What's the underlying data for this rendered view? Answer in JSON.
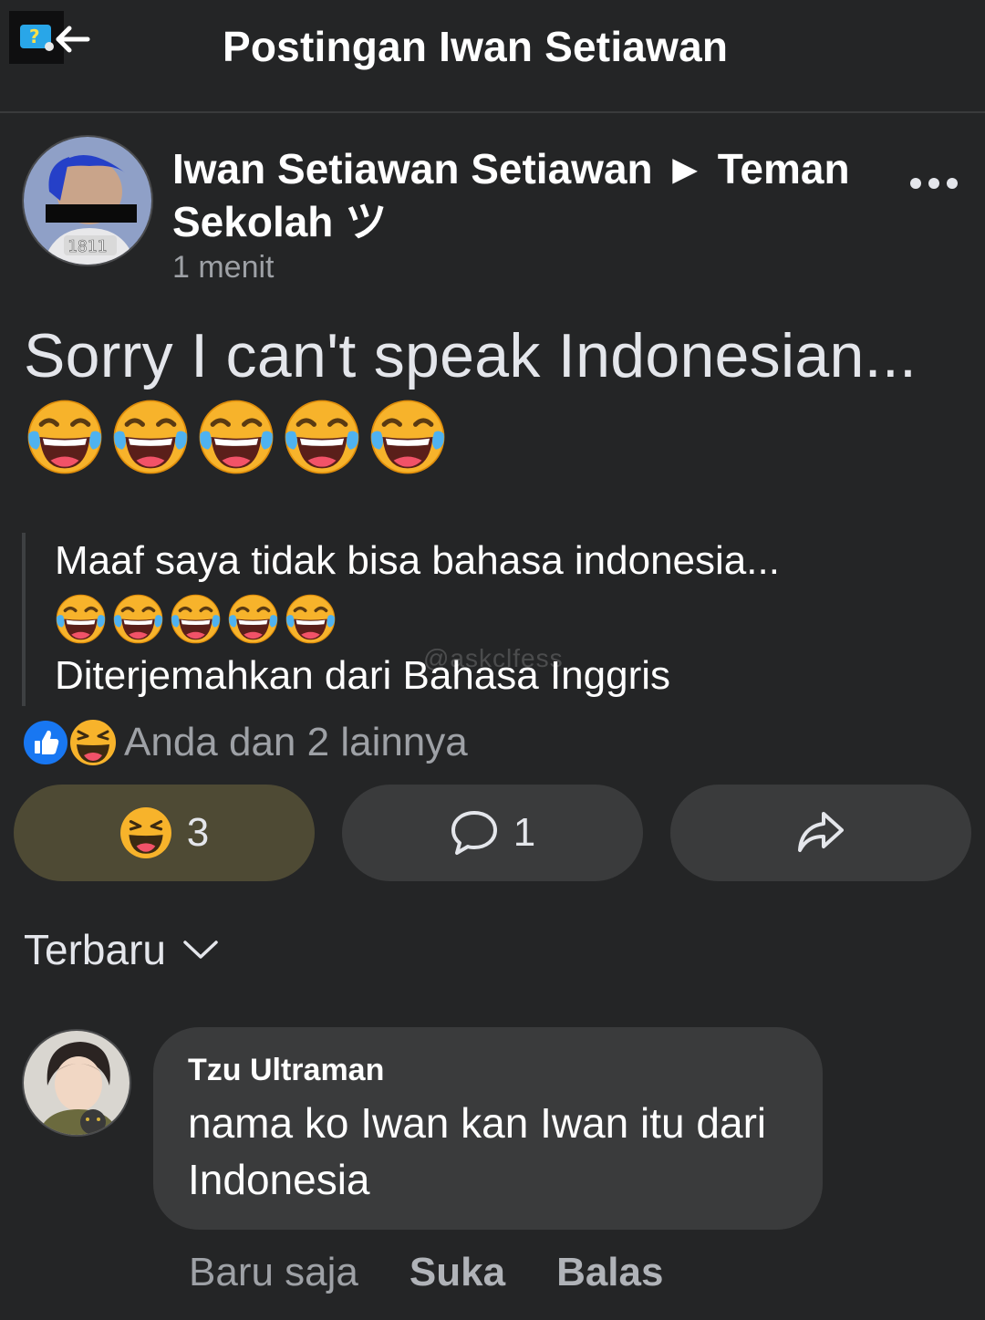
{
  "header": {
    "title": "Postingan Iwan Setiawan"
  },
  "post": {
    "author": "Iwan Setiawan Setiawan ► Teman Sekolah ツ",
    "time": "1 menit",
    "text": "Sorry I can't speak Indonesian...",
    "emoji_count": 5,
    "avatar_tag": "1811",
    "translation": {
      "text": "Maaf saya tidak bisa bahasa indonesia...",
      "note": "Diterjemahkan dari Bahasa Inggris"
    },
    "watermark": "@askclfess",
    "reactions_summary": "Anda dan 2 lainnya",
    "actions": {
      "react_count": "3",
      "comment_count": "1"
    }
  },
  "comments_sort": {
    "label": "Terbaru"
  },
  "comment": {
    "name": "Tzu Ultraman",
    "text": "nama ko Iwan kan Iwan itu dari Indonesia",
    "time": "Baru saja",
    "like_label": "Suka",
    "reply_label": "Balas"
  },
  "colors": {
    "background": "#242526",
    "button": "#3a3b3c",
    "react_active": "#4e4a34",
    "muted_text": "#9ea1a6",
    "like_blue": "#1877f2",
    "emoji_yellow": "#f7b32b"
  }
}
